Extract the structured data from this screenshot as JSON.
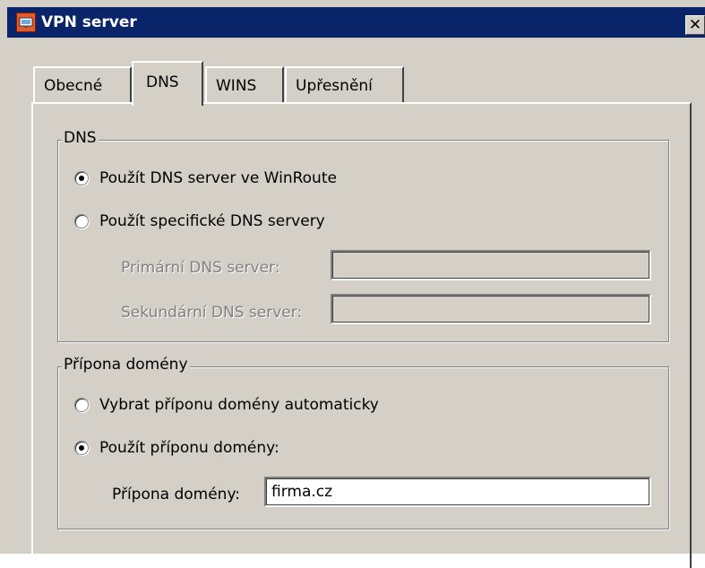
{
  "window": {
    "title": "VPN server",
    "close_label": "✕"
  },
  "tabs": [
    {
      "label": "Obecné",
      "active": false
    },
    {
      "label": "DNS",
      "active": true
    },
    {
      "label": "WINS",
      "active": false
    },
    {
      "label": "Upřesnění",
      "active": false
    }
  ],
  "dns_group": {
    "title": "DNS",
    "option_winroute": "Použít DNS server ve WinRoute",
    "option_winroute_checked": true,
    "option_specific": "Použít specifické DNS servery",
    "option_specific_checked": false,
    "primary_label": "Primární DNS server:",
    "primary_value": "",
    "secondary_label": "Sekundární DNS server:",
    "secondary_value": ""
  },
  "domain_group": {
    "title": "Přípona domény",
    "option_auto": "Vybrat příponu domény automaticky",
    "option_auto_checked": false,
    "option_manual": "Použít příponu domény:",
    "option_manual_checked": true,
    "suffix_label": "Přípona domény:",
    "suffix_value": "firma.cz"
  },
  "colors": {
    "titlebar": "#0a246a",
    "dialog_bg": "#d4d0c8"
  }
}
